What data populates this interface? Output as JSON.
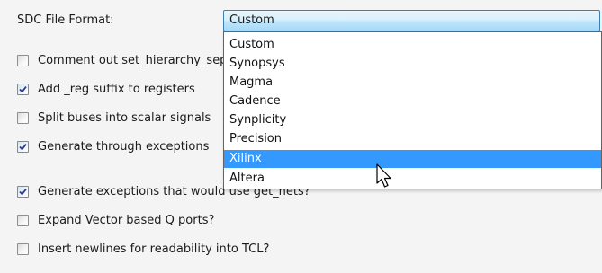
{
  "format": {
    "label": "SDC File Format:",
    "selected_value": "Custom"
  },
  "options": [
    {
      "label": "Comment out set_hierarchy_separator",
      "checked": false
    },
    {
      "label": "Add _reg suffix to registers",
      "checked": true
    },
    {
      "label": "Split buses into scalar signals",
      "checked": false
    },
    {
      "label": "Generate through exceptions",
      "checked": true
    },
    {
      "label": "Generate exceptions that would use get_nets?",
      "checked": true
    },
    {
      "label": "Expand Vector based Q ports?",
      "checked": false
    },
    {
      "label": "Insert newlines for readability into TCL?",
      "checked": false
    }
  ],
  "dropdown": {
    "items": [
      "Custom",
      "Synopsys",
      "Magma",
      "Cadence",
      "Synplicity",
      "Precision",
      "Xilinx",
      "Altera"
    ],
    "highlighted": "Xilinx"
  },
  "colors": {
    "selection": "#3399ff",
    "combo_border": "#3c7fb1"
  },
  "icons": {
    "checkmark": "check-icon",
    "pointer": "mouse-pointer-icon"
  }
}
